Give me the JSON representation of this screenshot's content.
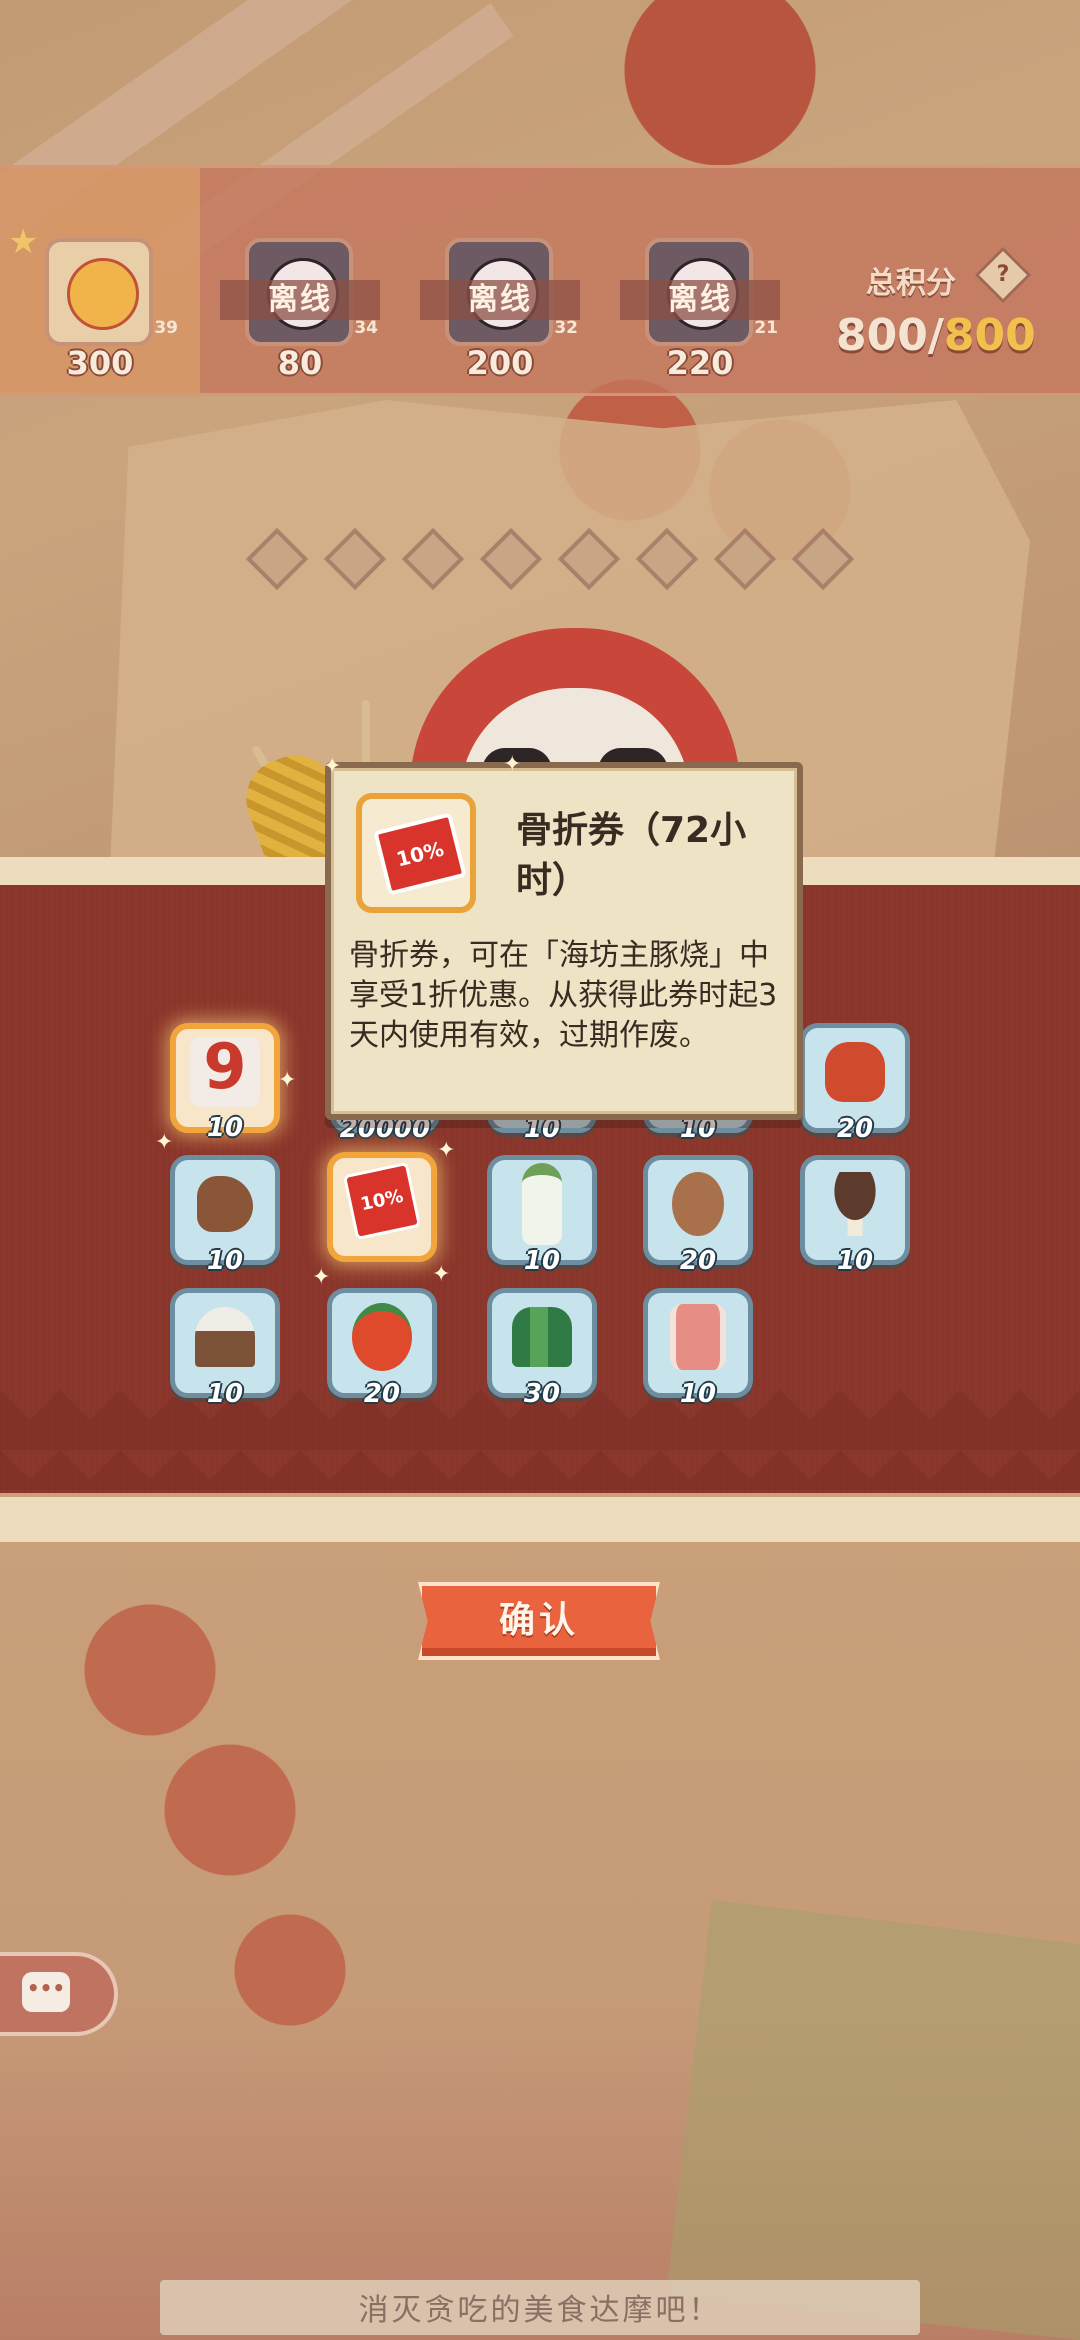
{
  "score_bar": {
    "players": [
      {
        "points": "300",
        "level": "39",
        "status": "",
        "is_self": true
      },
      {
        "points": "80",
        "level": "34",
        "status": "离线",
        "is_self": false
      },
      {
        "points": "200",
        "level": "32",
        "status": "离线",
        "is_self": false
      },
      {
        "points": "220",
        "level": "21",
        "status": "离线",
        "is_self": false
      }
    ],
    "total_label": "总积分",
    "total_current": "800/",
    "total_max": "800"
  },
  "rewards": [
    {
      "icon": "number-nine-token",
      "count": "10",
      "highlighted": true
    },
    {
      "icon": "coin-stack",
      "count": "20000",
      "highlighted": false
    },
    {
      "icon": "unknown-item",
      "count": "10",
      "highlighted": false
    },
    {
      "icon": "unknown-item",
      "count": "10",
      "highlighted": false
    },
    {
      "icon": "octopus",
      "count": "20",
      "highlighted": false
    },
    {
      "icon": "lizard",
      "count": "10",
      "highlighted": false
    },
    {
      "icon": "discount-coupon",
      "count": "",
      "highlighted": true
    },
    {
      "icon": "daikon-radish",
      "count": "10",
      "highlighted": false
    },
    {
      "icon": "potato",
      "count": "20",
      "highlighted": false
    },
    {
      "icon": "shiitake-mushroom",
      "count": "10",
      "highlighted": false
    },
    {
      "icon": "rice-sack",
      "count": "10",
      "highlighted": false
    },
    {
      "icon": "tomato",
      "count": "20",
      "highlighted": false
    },
    {
      "icon": "green-onion",
      "count": "30",
      "highlighted": false
    },
    {
      "icon": "pork-meat",
      "count": "10",
      "highlighted": false
    }
  ],
  "tooltip": {
    "icon": "discount-coupon",
    "coupon_text": "10%",
    "title": "骨折券（72小时）",
    "description": "骨折券，可在「海坊主豚烧」中享受1折优惠。从获得此券时起3天内使用有效，过期作废。"
  },
  "confirm_label": "确认",
  "caption": "消灭贪吃的美食达摩吧！",
  "colors": {
    "panel": "#8c372c",
    "button": "#e9643e",
    "highlight_border": "#f2a53b",
    "item_bg": "#c7e4ec"
  }
}
